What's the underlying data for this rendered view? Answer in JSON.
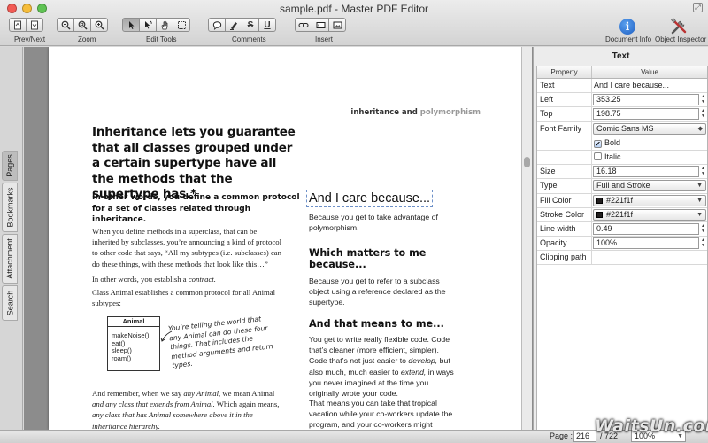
{
  "window": {
    "title": "sample.pdf - Master PDF Editor"
  },
  "toolbar": {
    "groups": {
      "prev_next": "Prev/Next",
      "zoom": "Zoom",
      "edit_tools": "Edit Tools",
      "comments": "Comments",
      "insert": "Insert",
      "document_info": "Document Info",
      "object_inspector": "Object Inspector"
    },
    "icons": {
      "prev": "prev-page-icon",
      "next": "next-page-icon",
      "zoom_out": "zoom-out-icon",
      "zoom_in": "zoom-in-icon",
      "zoom_fit": "zoom-fit-icon",
      "select": "arrow-cursor-icon",
      "edit_object": "edit-object-icon",
      "hand": "hand-icon",
      "marquee": "marquee-select-icon",
      "note": "note-icon",
      "highlight": "highlight-icon",
      "strikeout": "strikeout-icon",
      "underline": "underline-icon",
      "link": "link-icon",
      "text_field": "text-field-icon",
      "image": "image-icon",
      "info": "info-icon",
      "inspector": "tools-icon"
    },
    "labels": {
      "strikeout": "S",
      "underline": "U"
    }
  },
  "left_tabs": [
    "Pages",
    "Bookmarks",
    "Attachment",
    "Search"
  ],
  "document": {
    "page_header": {
      "bold": "inheritance and",
      "gray": "polymorphism"
    },
    "headline": "Inheritance lets you guarantee that all classes grouped under a certain supertype have all the methods that the supertype has.*",
    "subheadline": "In other words, you define a common protocol for a set of classes related through inheritance.",
    "left_p1": "When you define methods in a superclass, that can be inherited by subclasses, you’re announcing a kind of protocol to other code that says, “All my subtypes (i.e. subclasses) can do these things, with these methods that look like this…”",
    "left_p2_lead": "In other words, you establish a",
    "left_p2_em": "contract.",
    "left_p3": "Class Animal establishes a common protocol for all Animal subtypes:",
    "uml": {
      "class_name": "Animal",
      "methods": [
        "makeNoise()",
        "eat()",
        "sleep()",
        "roam()"
      ]
    },
    "handwritten_note": "You’re telling the world that any Animal can do these four things. That includes the method arguments and return types.",
    "left_p4_a": "And remember, when we say",
    "left_p4_em1": "any Animal,",
    "left_p4_b": "we mean Animal",
    "left_p4_em2": "and any class that extends from Animal.",
    "left_p4_c": "Which again means,",
    "left_p4_em3": "any class that has Animal somewhere above it in the inheritance hierarchy.",
    "selected_heading": "And I care because...",
    "right_p1": "Because you get to take advantage of polymorphism.",
    "right_h2": "Which matters to me because...",
    "right_p2": "Because you get to refer to a subclass object using a reference declared as the supertype.",
    "right_h3": "And that means to me...",
    "right_p3_a": "You get to write really flexible code. Code that’s cleaner (more efficient, simpler). Code that’s not just easier to",
    "right_p3_em1": "develop,",
    "right_p3_b": "but also much, much easier to",
    "right_p3_em2": "extend,",
    "right_p3_c": "in ways you never imagined at the time you originally wrote your code.",
    "right_p4": "That means you can take that tropical vacation while your co-workers update the program, and your co-workers might"
  },
  "inspector": {
    "title": "Text",
    "col_property": "Property",
    "col_value": "Value",
    "text_label": "Text",
    "text_value": "And I care because...",
    "left_label": "Left",
    "left_value": "353.25",
    "top_label": "Top",
    "top_value": "198.75",
    "font_family_label": "Font Family",
    "font_family_value": "Comic Sans MS",
    "bold_label": "Bold",
    "bold_checked": true,
    "italic_label": "Italic",
    "italic_checked": false,
    "size_label": "Size",
    "size_value": "16.18",
    "type_label": "Type",
    "type_value": "Full and Stroke",
    "fill_color_label": "Fill Color",
    "fill_color_value": "#221f1f",
    "stroke_color_label": "Stroke Color",
    "stroke_color_value": "#221f1f",
    "line_width_label": "Line width",
    "line_width_value": "0.49",
    "opacity_label": "Opacity",
    "opacity_value": "100%",
    "clipping_path_label": "Clipping path",
    "check_mark": "✔"
  },
  "statusbar": {
    "page_label": "Page :",
    "page_value": "216",
    "page_total": "/ 722",
    "zoom_value": "100%"
  },
  "watermark": "WaitsUn.com",
  "colors": {
    "fill_swatch": "#221f1f",
    "selection_border": "#6d90c8"
  }
}
